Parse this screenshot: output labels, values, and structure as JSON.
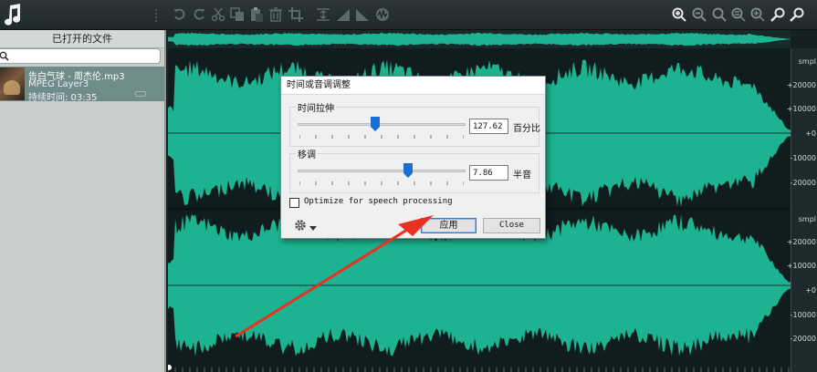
{
  "toolbar": {
    "icons": [
      "undo-icon",
      "redo-icon",
      "cut-icon",
      "copy-icon",
      "paste-icon",
      "delete-icon",
      "crop-icon",
      "normalize-icon",
      "fade-in-icon",
      "fade-out-icon",
      "effects-icon"
    ],
    "zoom_icons": [
      "zoom-in-icon",
      "zoom-out-icon",
      "zoom-selection-icon",
      "zoom-fit-icon",
      "zoom-full-icon",
      "zoom-horizontal-icon",
      "zoom-vertical-icon"
    ]
  },
  "sidebar": {
    "title": "已打开的文件",
    "search_placeholder": "",
    "file": {
      "name": "告白气球 - 周杰伦.mp3",
      "format": "MPEG Layer3",
      "duration": "持续时间: 03:35"
    }
  },
  "ruler": {
    "labels": [
      "smpl",
      "+20000",
      "+10000",
      "+0",
      "-10000",
      "-20000",
      "smpl",
      "+20000",
      "+10000",
      "+0",
      "-10000",
      "-20000"
    ]
  },
  "dialog": {
    "title": "时间或音调调整",
    "time_stretch": {
      "label": "时间拉伸",
      "value": "127.62",
      "unit": "百分比",
      "slider_fraction": 0.46
    },
    "pitch": {
      "label": "移调",
      "value": "7.86",
      "unit": "半音",
      "slider_fraction": 0.66
    },
    "optimize_label": "Optimize for speech processing",
    "optimize_checked": false,
    "apply_label": "应用",
    "close_label": "Close"
  },
  "colors": {
    "waveform": "#1db391",
    "background": "#152022",
    "arrow": "#e8321f",
    "slider_thumb": "#1a6fd1"
  }
}
